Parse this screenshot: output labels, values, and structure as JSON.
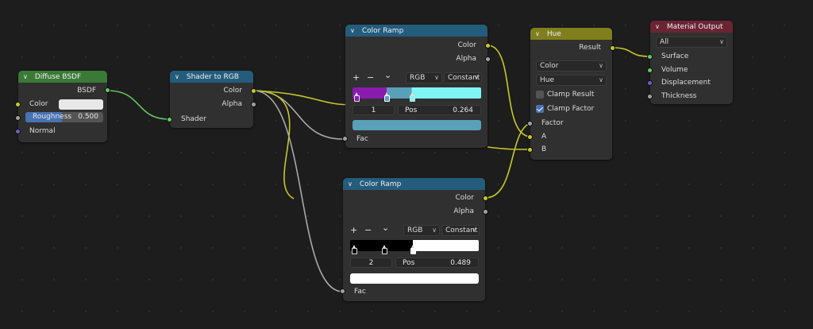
{
  "nodes": {
    "diffuse": {
      "title": "Diffuse BSDF",
      "output": "BSDF",
      "inputs": {
        "color": "Color",
        "roughness_label": "Roughness",
        "roughness_value": "0.500",
        "normal": "Normal"
      },
      "roughness_fraction": 0.5,
      "color_value": "#e8e8e8",
      "header_color": "#3a7a36"
    },
    "shader_to_rgb": {
      "title": "Shader to RGB",
      "outputs": {
        "color": "Color",
        "alpha": "Alpha"
      },
      "input": "Shader",
      "header_color": "#245c7c"
    },
    "ramp1": {
      "title": "Color Ramp",
      "outputs": {
        "color": "Color",
        "alpha": "Alpha"
      },
      "tools": {
        "add": "+",
        "remove": "−",
        "menu": "⌄"
      },
      "color_mode": "RGB",
      "interpolation": "Constant",
      "stop_index": "1",
      "pos_label": "Pos",
      "pos_value": "0.264",
      "stops": [
        {
          "pos": 0.0,
          "color": "#8a1bb0"
        },
        {
          "pos": 0.264,
          "color": "#5aa0b8"
        },
        {
          "pos": 0.46,
          "color": "#7ff5f5"
        }
      ],
      "active_color": "#5aa0b8",
      "input": "Fac",
      "header_color": "#245c7c"
    },
    "ramp2": {
      "title": "Color Ramp",
      "outputs": {
        "color": "Color",
        "alpha": "Alpha"
      },
      "tools": {
        "add": "+",
        "remove": "−",
        "menu": "⌄"
      },
      "color_mode": "RGB",
      "interpolation": "Constant",
      "stop_index": "2",
      "pos_label": "Pos",
      "pos_value": "0.489",
      "stops": [
        {
          "pos": 0.0,
          "color": "#000000"
        },
        {
          "pos": 0.26,
          "color": "#000000"
        },
        {
          "pos": 0.489,
          "color": "#ffffff"
        }
      ],
      "active_color": "#ffffff",
      "input": "Fac",
      "header_color": "#245c7c"
    },
    "hue": {
      "title": "Hue",
      "output": "Result",
      "blend_type": "Color",
      "mode": "Hue",
      "clamp_result": {
        "label": "Clamp Result",
        "checked": false
      },
      "clamp_factor": {
        "label": "Clamp Factor",
        "checked": true
      },
      "inputs": {
        "factor": "Factor",
        "a": "A",
        "b": "B"
      },
      "header_color": "#7f7f1e"
    },
    "material_output": {
      "title": "Material Output",
      "target": "All",
      "inputs": {
        "surface": "Surface",
        "volume": "Volume",
        "displacement": "Displacement",
        "thickness": "Thickness"
      },
      "header_color": "#6b2434"
    }
  },
  "colors": {
    "socket_shader": "#63c763",
    "socket_color": "#c7c729",
    "socket_float": "#a1a1a1",
    "socket_vector": "#6363c7"
  }
}
